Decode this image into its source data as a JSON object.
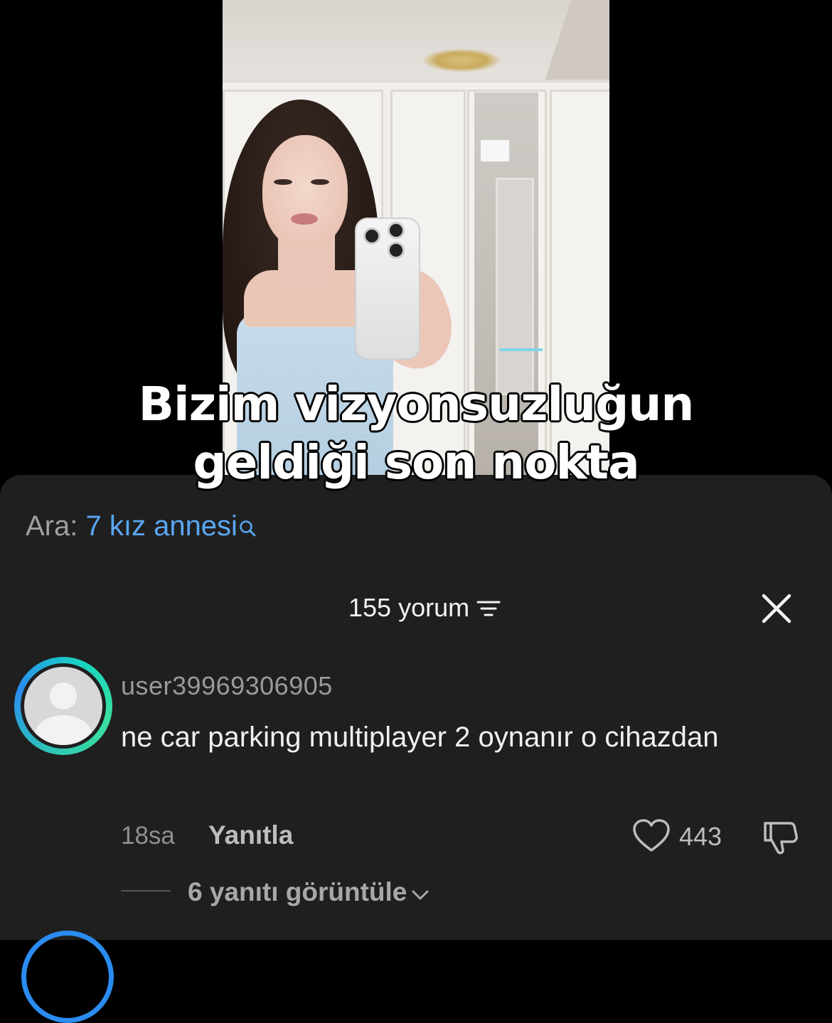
{
  "video": {
    "caption_lines": [
      "Bizim vizyonsuzluğun",
      "geldiği son nokta"
    ]
  },
  "search": {
    "prefix": "Ara:",
    "query": "7 kız annesi",
    "icon": "search-icon",
    "prefix_color": "#a0a0a0",
    "query_color": "#5aa7f2"
  },
  "comments_header": {
    "count_label": "155 yorum",
    "sort_icon": "sort-icon",
    "close_icon": "close-icon"
  },
  "comments": [
    {
      "username": "user39969306905",
      "text": "ne car parking multiplayer 2 oynanır o cihazdan",
      "time": "18sa",
      "reply_label": "Yanıtla",
      "like_count": "443",
      "view_replies_label": "6 yanıtı görüntüle",
      "avatar_icon": "default-avatar-icon",
      "avatar_ring_colors": [
        "#2ec4b6",
        "#2a8cf0"
      ]
    }
  ],
  "colors": {
    "panel_bg": "#1f1f1f",
    "page_bg": "#000000",
    "link_blue": "#5aa7f2"
  }
}
